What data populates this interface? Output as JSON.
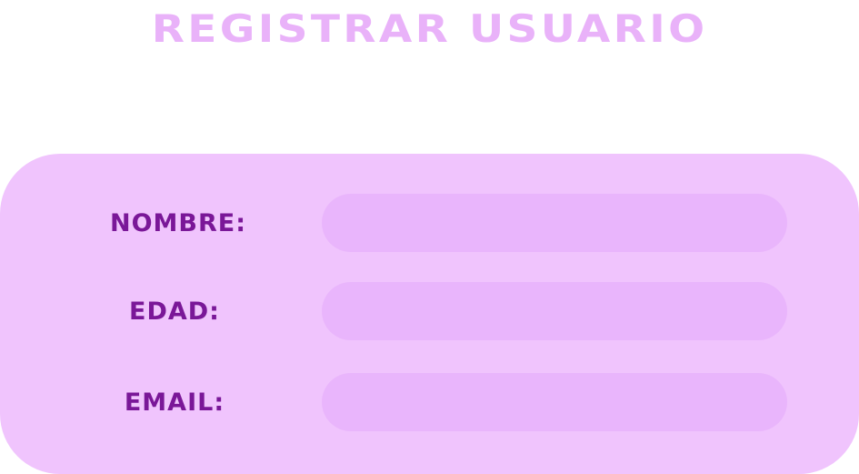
{
  "form": {
    "title": "REGISTRAR USUARIO",
    "fields": [
      {
        "label": "NOMBRE:",
        "value": "",
        "placeholder": ""
      },
      {
        "label": "EDAD:",
        "value": "",
        "placeholder": ""
      },
      {
        "label": "EMAIL:",
        "value": "",
        "placeholder": ""
      }
    ]
  },
  "colors": {
    "title": "#e9b2f9",
    "card_background": "#f0c4fd",
    "input_background": "#e9b5fc",
    "label_text": "#7a1798",
    "page_background": "#ffffff"
  }
}
